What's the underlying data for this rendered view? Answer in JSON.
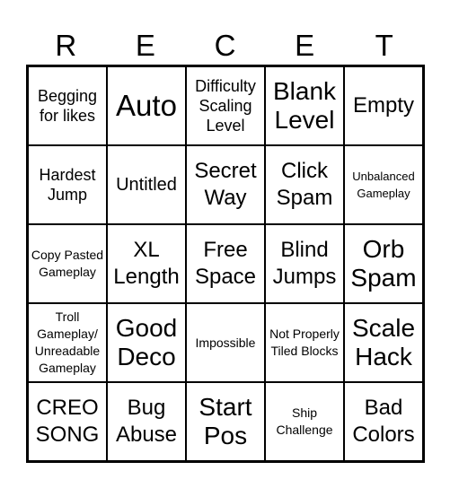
{
  "title_letters": [
    "R",
    "E",
    "C",
    "E",
    "T"
  ],
  "cells": [
    [
      "Begging for likes",
      "Auto",
      "Difficulty Scaling Level",
      "Blank Level",
      "Empty"
    ],
    [
      "Hardest Jump",
      "Untitled",
      "Secret Way",
      "Click Spam",
      "Unbalanced Gameplay"
    ],
    [
      "Copy Pasted Gameplay",
      "XL Length",
      "Free Space",
      "Blind Jumps",
      "Orb Spam"
    ],
    [
      "Troll Gameplay/ Unreadable Gameplay",
      "Good Deco",
      "Impossible",
      "Not Properly Tiled Blocks",
      "Scale Hack"
    ],
    [
      "CREO SONG",
      "Bug Abuse",
      "Start Pos",
      "Ship Challenge",
      "Bad Colors"
    ]
  ]
}
